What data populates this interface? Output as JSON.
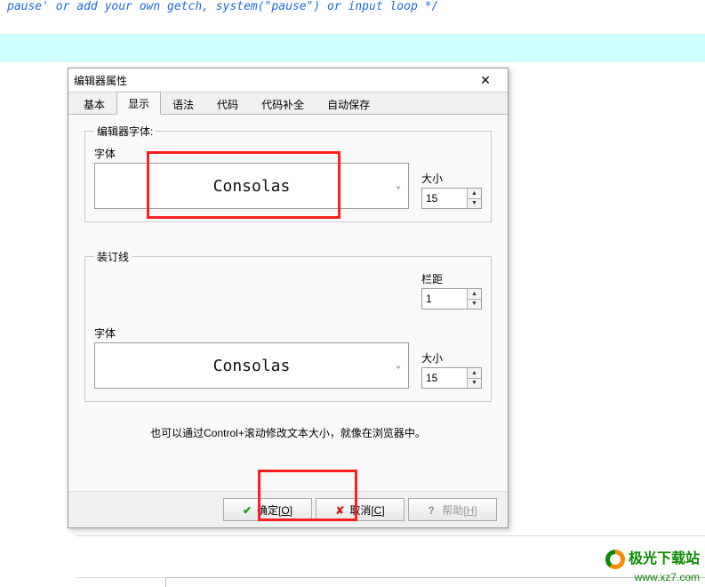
{
  "bg": {
    "code_line": "pause' or add your own getch, system(\"pause\") or input loop */"
  },
  "dialog": {
    "title": "编辑器属性",
    "tabs": [
      {
        "label": "基本"
      },
      {
        "label": "显示"
      },
      {
        "label": "语法"
      },
      {
        "label": "代码"
      },
      {
        "label": "代码补全"
      },
      {
        "label": "自动保存"
      }
    ],
    "active_tab": 1,
    "group_editor_font": {
      "legend": "编辑器字体:",
      "font_label": "字体",
      "font_value": "Consolas",
      "size_label": "大小",
      "size_value": "15"
    },
    "group_gutter": {
      "legend": "装订线",
      "span_label": "栏距",
      "span_value": "1",
      "font_label": "字体",
      "font_value": "Consolas",
      "size_label": "大小",
      "size_value": "15"
    },
    "hint": "也可以通过Control+滚动修改文本大小，就像在浏览器中。",
    "buttons": {
      "ok": "确定[O]",
      "ok_mnemonic": "O",
      "cancel": "取消[C]",
      "cancel_mnemonic": "C",
      "help": "帮助[H]",
      "help_mnemonic": "H"
    }
  },
  "watermark": {
    "title": "极光下载站",
    "url": "www.xz7.com"
  }
}
